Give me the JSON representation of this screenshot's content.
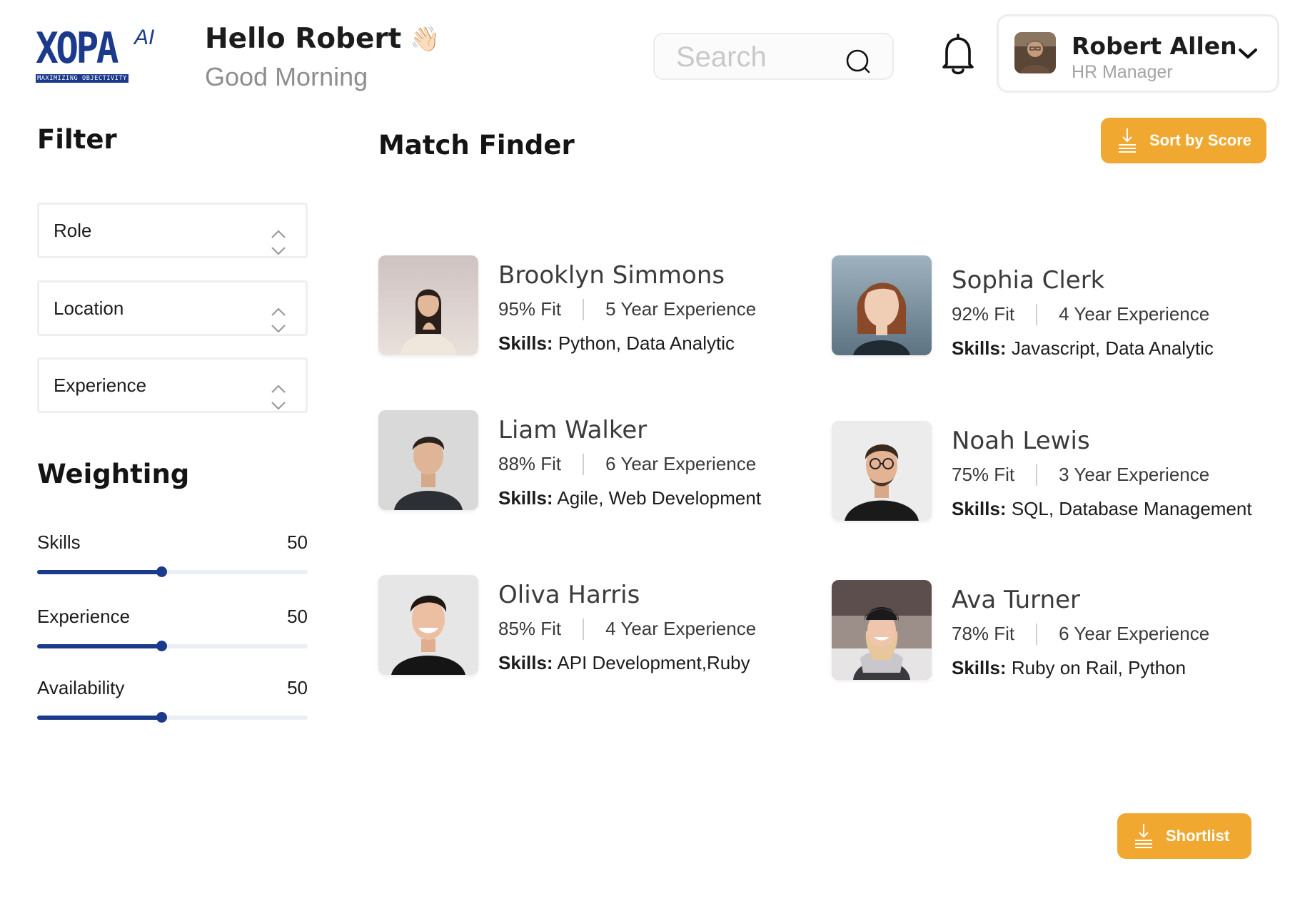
{
  "brand": {
    "logo_text": "XOPA",
    "logo_superscript": "AI",
    "tagline": "MAXIMIZING OBJECTIVITY",
    "color": "#1b3a8c"
  },
  "header": {
    "greeting": "Hello Robert",
    "wave_emoji": "👋🏻",
    "subtitle": "Good Morning",
    "search_placeholder": "Search",
    "user": {
      "name": "Robert Allen",
      "role": "HR Manager"
    }
  },
  "filter": {
    "title": "Filter",
    "selects": [
      {
        "label": "Role"
      },
      {
        "label": "Location"
      },
      {
        "label": "Experience"
      }
    ]
  },
  "weighting": {
    "title": "Weighting",
    "max": 100,
    "items": [
      {
        "label": "Skills",
        "value": "50",
        "fraction": 0.46
      },
      {
        "label": "Experience",
        "value": "50",
        "fraction": 0.46
      },
      {
        "label": "Availability",
        "value": "50",
        "fraction": 0.46
      }
    ]
  },
  "match": {
    "title": "Match Finder",
    "sort_label": "Sort by Score",
    "shortlist_label": "Shortlist",
    "skills_label": "Skills:",
    "candidates": [
      {
        "name": "Brooklyn Simmons",
        "fit": "95% Fit",
        "experience": "5 Year Experience",
        "skills": "Python, Data Analytic"
      },
      {
        "name": "Sophia Clerk",
        "fit": "92% Fit",
        "experience": "4 Year Experience",
        "skills": "Javascript, Data Analytic"
      },
      {
        "name": "Liam Walker",
        "fit": "88% Fit",
        "experience": "6 Year Experience",
        "skills": "Agile, Web Development"
      },
      {
        "name": "Noah Lewis",
        "fit": "75% Fit",
        "experience": "3 Year Experience",
        "skills": "SQL, Database Management"
      },
      {
        "name": "Oliva Harris",
        "fit": "85% Fit",
        "experience": "4 Year Experience",
        "skills": "API Development,Ruby"
      },
      {
        "name": "Ava Turner",
        "fit": "78% Fit",
        "experience": "6 Year Experience",
        "skills": "Ruby on Rail, Python"
      }
    ]
  },
  "colors": {
    "accent": "#f0a830",
    "primary": "#1b3a8c",
    "muted_text": "#8e8e8e"
  }
}
